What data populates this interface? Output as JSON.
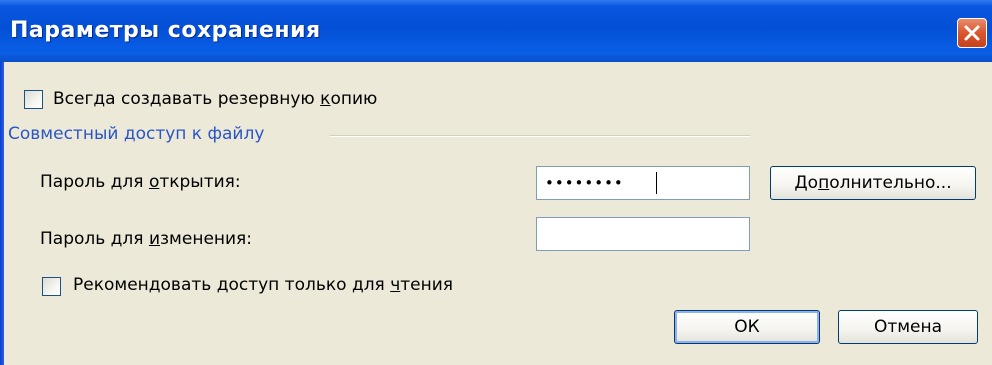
{
  "window": {
    "title": "Параметры сохранения",
    "close_icon": "close-icon",
    "colors": {
      "titlebar": "#0350d6",
      "close_button": "#d8572e",
      "background": "#ece9d8",
      "group_title": "#2a55c8"
    }
  },
  "backup": {
    "label_before": "Всегда создавать резервную ",
    "label_mnemonic": "к",
    "label_after": "опию",
    "checked": false
  },
  "sharing": {
    "group_title": "Совместный доступ к файлу",
    "open_password": {
      "label_before": "Пароль для ",
      "label_mnemonic": "о",
      "label_after": "ткрытия:",
      "value": "••••••••"
    },
    "modify_password": {
      "label_before": "Пароль для ",
      "label_mnemonic": "и",
      "label_after": "зменения:",
      "value": ""
    },
    "advanced_button": {
      "label_before": "До",
      "label_mnemonic": "п",
      "label_after": "олнительно..."
    },
    "readonly": {
      "label_before": "Рекомендовать доступ только для ",
      "label_mnemonic": "ч",
      "label_after": "тения",
      "checked": false
    }
  },
  "buttons": {
    "ok": "ОК",
    "cancel": "Отмена"
  }
}
